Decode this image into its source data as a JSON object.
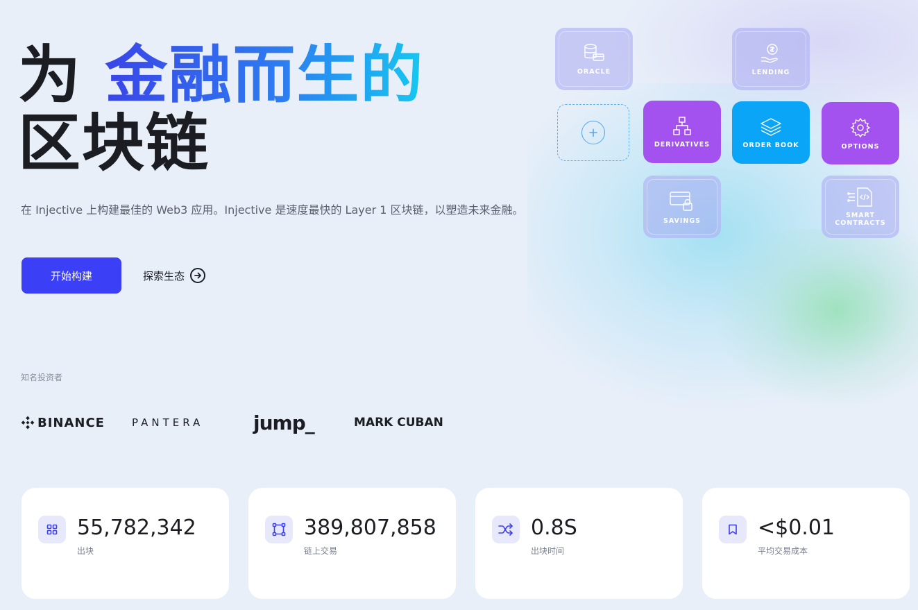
{
  "hero": {
    "title_prefix": "为",
    "title_highlight": "金融而生的",
    "title_line2": "区块链",
    "subtitle": "在 Injective 上构建最佳的 Web3 应用。Injective 是速度最快的 Layer 1 区块链，以塑造未来金融。",
    "primary_button": "开始构建",
    "secondary_link": "探索生态"
  },
  "investors": {
    "label": "知名投资者",
    "logos": [
      {
        "name": "BINANCE"
      },
      {
        "name": "PANTERA"
      },
      {
        "name": "jump_"
      },
      {
        "name": "MARK CUBAN"
      }
    ]
  },
  "tiles": {
    "oracle": "ORACLE",
    "lending": "LENDING",
    "derivatives": "DERIVATIVES",
    "order_book": "ORDER BOOK",
    "options": "OPTIONS",
    "savings": "SAVINGS",
    "smart_contracts": "SMART CONTRACTS"
  },
  "stats": [
    {
      "value": "55,782,342",
      "label": "出块",
      "icon": "grid-icon"
    },
    {
      "value": "389,807,858",
      "label": "链上交易",
      "icon": "nodes-icon"
    },
    {
      "value": "0.8S",
      "label": "出块时间",
      "icon": "shuffle-icon"
    },
    {
      "value": "<$0.01",
      "label": "平均交易成本",
      "icon": "bookmark-icon"
    }
  ],
  "colors": {
    "primary": "#3b3ff5",
    "purple_tile": "#a352f0",
    "blue_tile": "#0aa5f6",
    "ghost_tile": "#a8aaf0"
  }
}
